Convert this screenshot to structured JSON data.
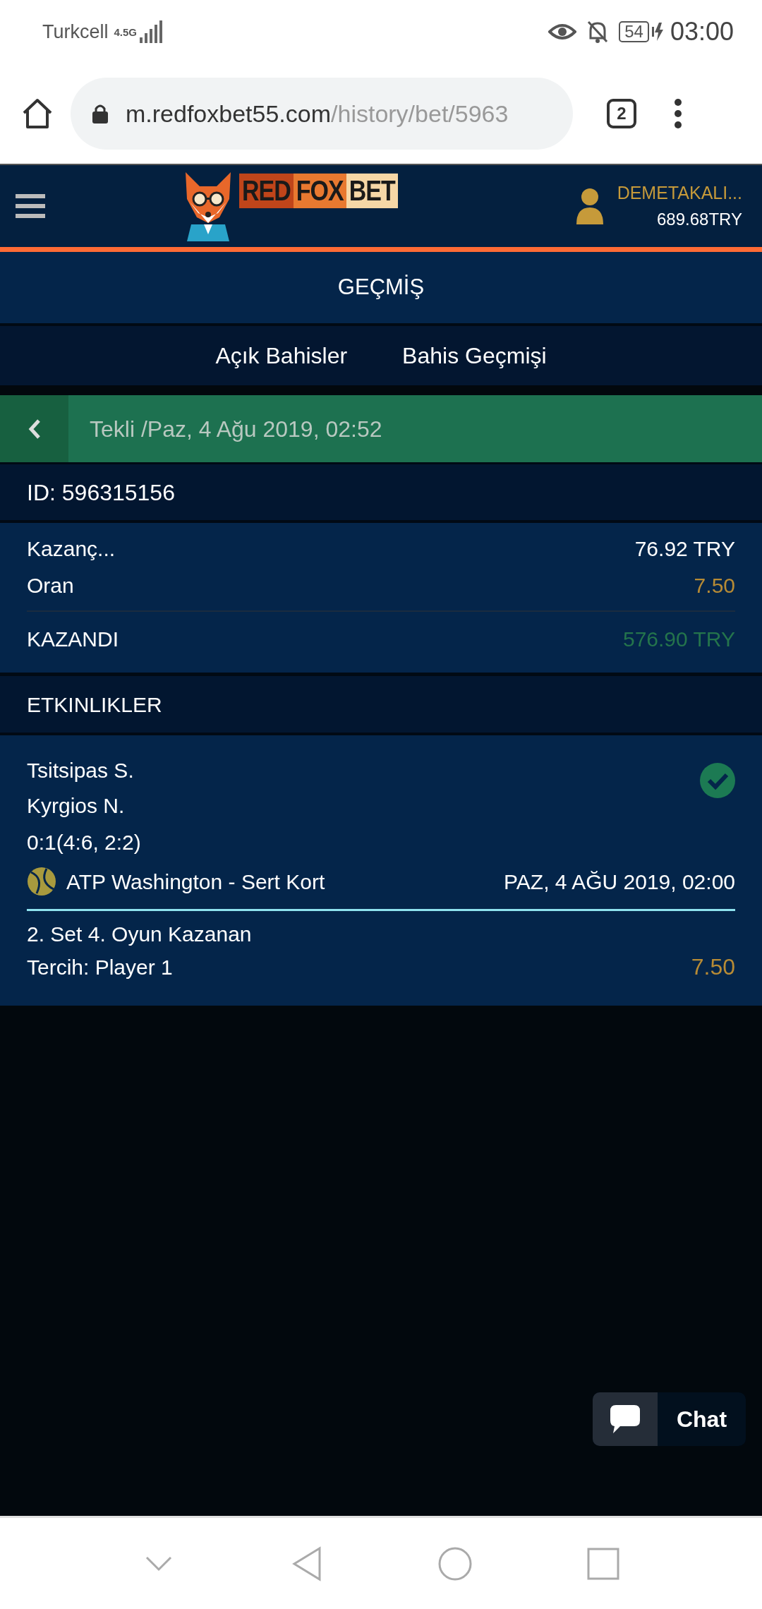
{
  "status_bar": {
    "carrier": "Turkcell",
    "network": "4.5G",
    "battery": "54",
    "time": "03:00"
  },
  "browser": {
    "url_host": "m.redfoxbet55.com",
    "url_path": "/history/bet/5963",
    "tab_count": "2"
  },
  "header": {
    "logo": [
      "RED",
      "FOX",
      "BET"
    ],
    "username": "DEMETAKALI...",
    "balance": "689.68TRY"
  },
  "page_title": "GEÇMİŞ",
  "tabs": [
    {
      "label": "Açık Bahisler",
      "selected": false
    },
    {
      "label": "Bahis Geçmişi",
      "selected": false
    }
  ],
  "bet": {
    "title": "Tekli /Paz, 4 Ağu 2019, 02:52",
    "id": "ID: 596315156",
    "summary": [
      {
        "label": "Kazanç...",
        "value": "76.92 TRY",
        "kind": "plain"
      },
      {
        "label": "Oran",
        "value": "7.50",
        "kind": "odds"
      },
      {
        "label": "KAZANDI",
        "value": "576.90 TRY",
        "kind": "won"
      }
    ]
  },
  "events_title": "ETKINLIKLER",
  "events": [
    {
      "team_1": "Tsitsipas S.",
      "team_2": "Kyrgios N.",
      "score": "0:1(4:6, 2:2)",
      "won": true,
      "league": "ATP Washington - Sert Kort",
      "start": "PAZ, 4 AĞU 2019, 02:00",
      "market": "2. Set 4. Oyun Kazanan",
      "pick": "Tercih: Player 1",
      "odds": "7.50"
    }
  ],
  "chat": {
    "label": "Chat"
  }
}
